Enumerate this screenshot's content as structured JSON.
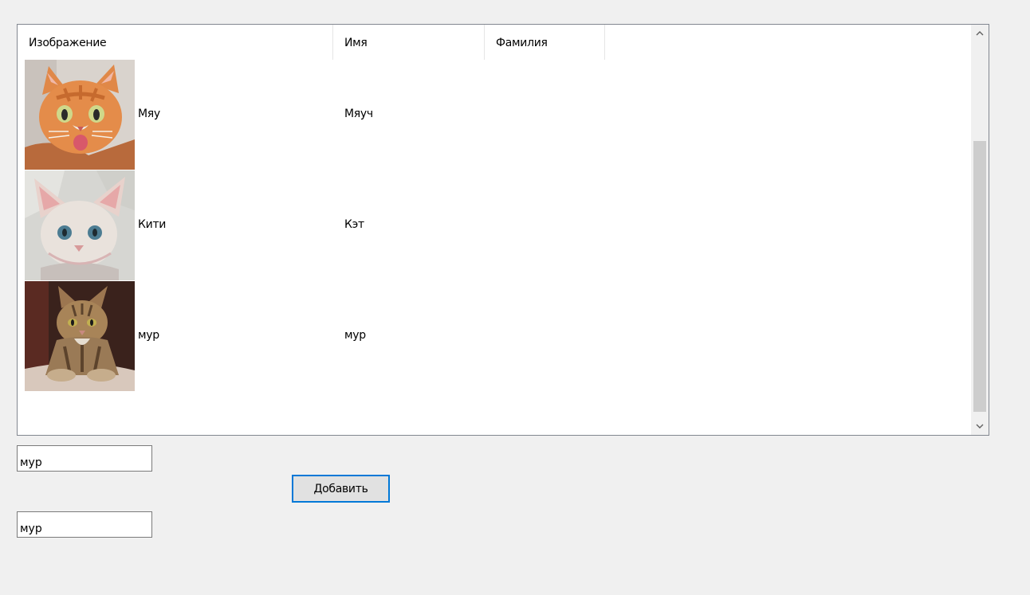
{
  "listview": {
    "columns": [
      {
        "label": "Изображение"
      },
      {
        "label": "Имя"
      },
      {
        "label": "Фамилия"
      }
    ],
    "rows": [
      {
        "image": "orange-cat-photo",
        "col0": "Мяу",
        "col1": "Мяуч"
      },
      {
        "image": "sphynx-cat-photo",
        "col0": "Кити",
        "col1": "Кэт"
      },
      {
        "image": "tabby-cat-photo",
        "col0": "мур",
        "col1": "мур"
      }
    ]
  },
  "form": {
    "first_input_value": "мур",
    "second_input_value": "мур",
    "add_button_label": "Добавить"
  },
  "icons": {
    "scroll_up": "chevron-up-icon",
    "scroll_down": "chevron-down-icon"
  },
  "colors": {
    "window_bg": "#f0f0f0",
    "list_bg": "#ffffff",
    "button_focus": "#0078d7",
    "scroll_thumb": "#cdcdcd"
  }
}
